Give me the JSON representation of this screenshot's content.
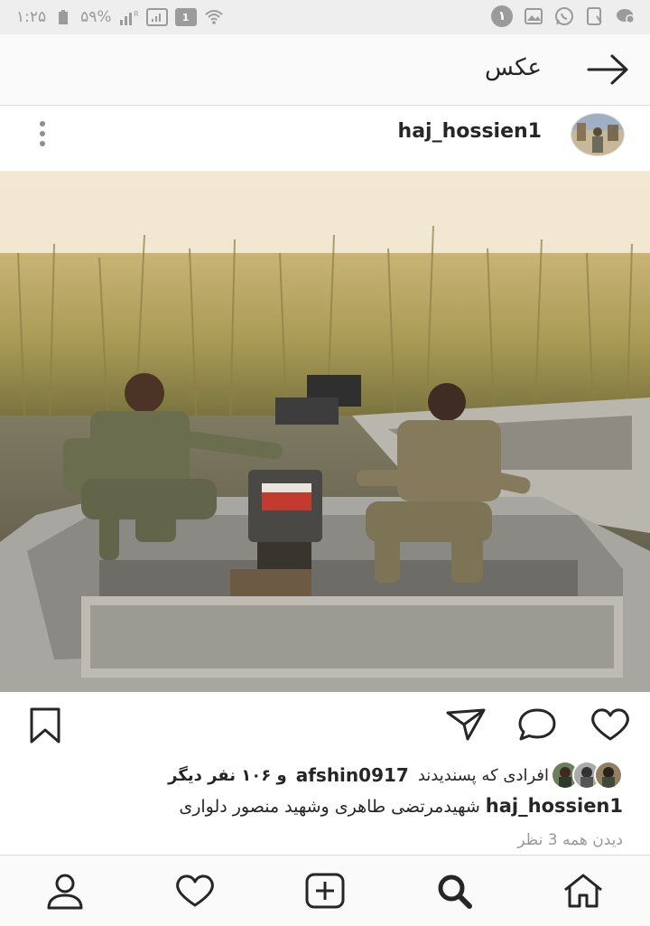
{
  "status_bar": {
    "time": "۱:۲۵",
    "battery": "۵۹%",
    "notification_count": "۱",
    "sim_box": "1",
    "signal_label": "R",
    "icons": [
      "battery-icon",
      "signal-icon",
      "sim-icon",
      "wifi-icon",
      "messages-icon",
      "download-icon",
      "whatsapp-icon",
      "gallery-icon"
    ]
  },
  "app_bar": {
    "title": "عکس",
    "back_icon": "arrow-icon"
  },
  "post": {
    "username": "haj_hossien1",
    "image_alt": "Two soldiers sitting in a motorboat among tall reeds",
    "liked_by_prefix": "افرادی که پسندیدند",
    "liked_by_user": "afshin0917",
    "liked_by_suffix": "و ۱۰۶ نفر دیگر",
    "caption_user": "haj_hossien1",
    "caption_text": "شهیدمرتضی  طاهری  وشهید منصور  دلواری",
    "view_comments": "دیدن همه 3 نظر"
  },
  "colors": {
    "text": "#262626",
    "muted": "#999999",
    "border": "#dbdbdb"
  }
}
